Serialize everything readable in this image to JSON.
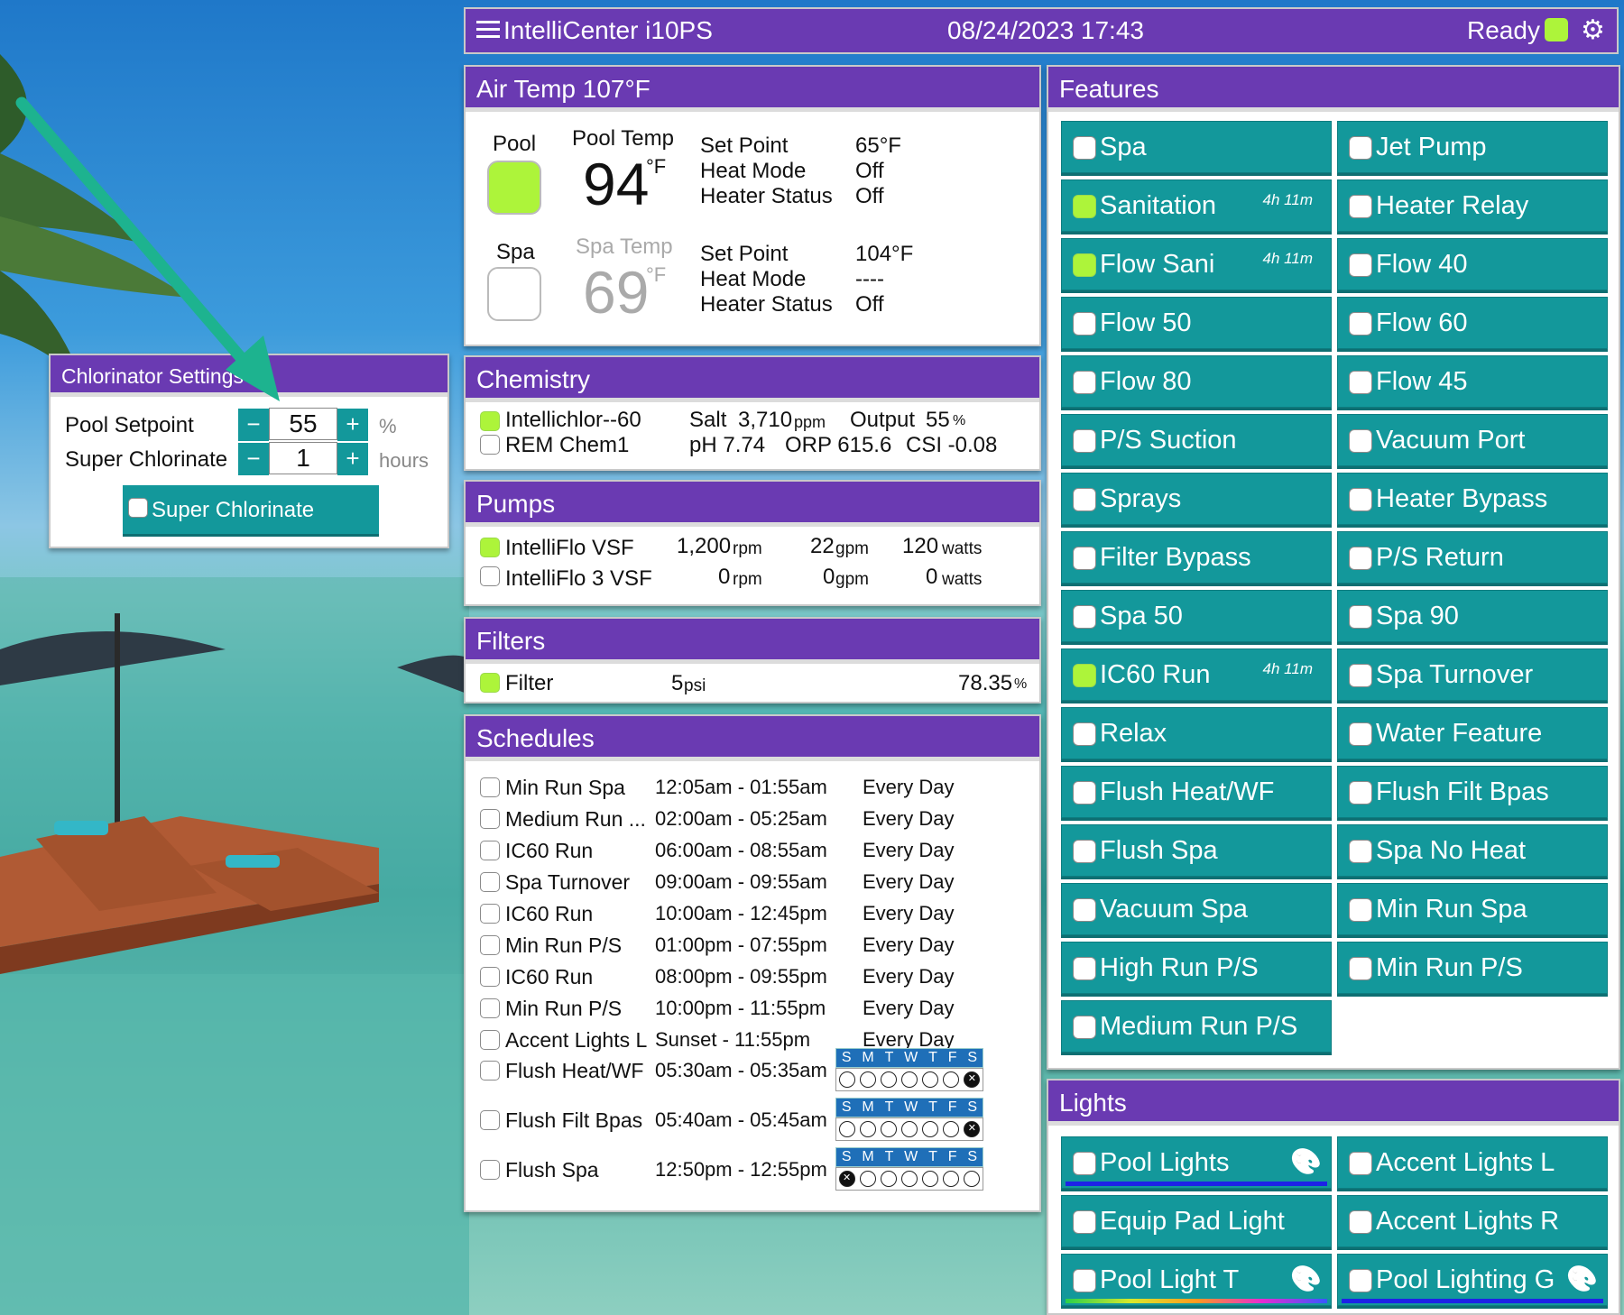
{
  "topbar": {
    "menu_icon": "hamburger-menu-icon",
    "title": "IntelliCenter i10PS",
    "datetime": "08/24/2023 17:43",
    "status": "Ready",
    "settings_icon": "gears-icon"
  },
  "airtemp": {
    "header": "Air Temp  107°F",
    "pool": {
      "label": "Pool",
      "temp_label": "Pool Temp",
      "temp": "94",
      "unit": "°F",
      "on": true,
      "setpoint_label": "Set Point",
      "setpoint": "65°F",
      "heatmode_label": "Heat Mode",
      "heatmode": "Off",
      "heater_label": "Heater Status",
      "heater": "Off"
    },
    "spa": {
      "label": "Spa",
      "temp_label": "Spa Temp",
      "temp": "69",
      "unit": "°F",
      "on": false,
      "setpoint_label": "Set Point",
      "setpoint": "104°F",
      "heatmode_label": "Heat Mode",
      "heatmode": "----",
      "heater_label": "Heater Status",
      "heater": "Off"
    }
  },
  "chemistry": {
    "header": "Chemistry",
    "rows": [
      {
        "name": "Intellichlor--60",
        "on": true
      },
      {
        "name": "REM Chem1",
        "on": false
      }
    ],
    "salt_label": "Salt",
    "salt": "3,710",
    "salt_unit": "ppm",
    "output_label": "Output",
    "output": "55",
    "output_unit": "%",
    "ph": "pH 7.74",
    "orp": "ORP 615.6",
    "csi": "CSI -0.08"
  },
  "pumps": {
    "header": "Pumps",
    "rows": [
      {
        "name": "IntelliFlo VSF",
        "on": true,
        "rpm": "1,200",
        "rpm_unit": "rpm",
        "gpm": "22",
        "gpm_unit": "gpm",
        "watts": "120",
        "watts_unit": "watts"
      },
      {
        "name": "IntelliFlo 3 VSF",
        "on": false,
        "rpm": "0",
        "rpm_unit": "rpm",
        "gpm": "0",
        "gpm_unit": "gpm",
        "watts": "0",
        "watts_unit": "watts"
      }
    ]
  },
  "filters": {
    "header": "Filters",
    "name": "Filter",
    "psi": "5",
    "psi_unit": "psi",
    "pct": "78.35",
    "pct_unit": "%"
  },
  "schedules": {
    "header": "Schedules",
    "day_letters": [
      "S",
      "M",
      "T",
      "W",
      "T",
      "F",
      "S"
    ],
    "rows": [
      {
        "name": "Min Run Spa",
        "time": "12:05am - 01:55am",
        "days": "Every Day"
      },
      {
        "name": "Medium Run ...",
        "time": "02:00am - 05:25am",
        "days": "Every Day"
      },
      {
        "name": "IC60 Run",
        "time": "06:00am - 08:55am",
        "days": "Every Day"
      },
      {
        "name": "Spa Turnover",
        "time": "09:00am - 09:55am",
        "days": "Every Day"
      },
      {
        "name": "IC60 Run",
        "time": "10:00am - 12:45pm",
        "days": "Every Day"
      },
      {
        "name": "Min Run P/S",
        "time": "01:00pm - 07:55pm",
        "days": "Every Day"
      },
      {
        "name": "IC60 Run",
        "time": "08:00pm - 09:55pm",
        "days": "Every Day"
      },
      {
        "name": "Min Run P/S",
        "time": "10:00pm - 11:55pm",
        "days": "Every Day"
      },
      {
        "name": "Accent Lights L",
        "time": "Sunset - 11:55pm",
        "days": "Every Day"
      },
      {
        "name": "Flush Heat/WF",
        "time": "05:30am - 05:35am",
        "days": "",
        "week": [
          0,
          0,
          0,
          0,
          0,
          0,
          1
        ]
      },
      {
        "name": "Flush Filt Bpas",
        "time": "05:40am - 05:45am",
        "days": "",
        "week": [
          0,
          0,
          0,
          0,
          0,
          0,
          1
        ]
      },
      {
        "name": "Flush Spa",
        "time": "12:50pm - 12:55pm",
        "days": "",
        "week": [
          1,
          0,
          0,
          0,
          0,
          0,
          0
        ]
      }
    ]
  },
  "features": {
    "header": "Features",
    "items": [
      {
        "label": "Spa",
        "on": false,
        "timer": ""
      },
      {
        "label": "Jet Pump",
        "on": false,
        "timer": ""
      },
      {
        "label": "Sanitation",
        "on": true,
        "timer": "4h 11m"
      },
      {
        "label": "Heater Relay",
        "on": false,
        "timer": ""
      },
      {
        "label": "Flow Sani",
        "on": true,
        "timer": "4h 11m"
      },
      {
        "label": "Flow 40",
        "on": false,
        "timer": ""
      },
      {
        "label": "Flow 50",
        "on": false,
        "timer": ""
      },
      {
        "label": "Flow 60",
        "on": false,
        "timer": ""
      },
      {
        "label": "Flow 80",
        "on": false,
        "timer": ""
      },
      {
        "label": "Flow 45",
        "on": false,
        "timer": ""
      },
      {
        "label": "P/S Suction",
        "on": false,
        "timer": ""
      },
      {
        "label": "Vacuum Port",
        "on": false,
        "timer": ""
      },
      {
        "label": "Sprays",
        "on": false,
        "timer": ""
      },
      {
        "label": "Heater Bypass",
        "on": false,
        "timer": ""
      },
      {
        "label": "Filter Bypass",
        "on": false,
        "timer": ""
      },
      {
        "label": "P/S Return",
        "on": false,
        "timer": ""
      },
      {
        "label": "Spa 50",
        "on": false,
        "timer": ""
      },
      {
        "label": "Spa 90",
        "on": false,
        "timer": ""
      },
      {
        "label": "IC60 Run",
        "on": true,
        "timer": "4h 11m"
      },
      {
        "label": "Spa Turnover",
        "on": false,
        "timer": ""
      },
      {
        "label": "Relax",
        "on": false,
        "timer": ""
      },
      {
        "label": "Water Feature",
        "on": false,
        "timer": ""
      },
      {
        "label": "Flush Heat/WF",
        "on": false,
        "timer": ""
      },
      {
        "label": "Flush Filt Bpas",
        "on": false,
        "timer": ""
      },
      {
        "label": "Flush Spa",
        "on": false,
        "timer": ""
      },
      {
        "label": "Spa No Heat",
        "on": false,
        "timer": ""
      },
      {
        "label": "Vacuum Spa",
        "on": false,
        "timer": ""
      },
      {
        "label": "Min Run Spa",
        "on": false,
        "timer": ""
      },
      {
        "label": "High Run P/S",
        "on": false,
        "timer": ""
      },
      {
        "label": "Min Run P/S",
        "on": false,
        "timer": ""
      },
      {
        "label": "Medium Run P/S",
        "on": false,
        "timer": ""
      }
    ]
  },
  "lights": {
    "header": "Lights",
    "items": [
      {
        "label": "Pool Lights",
        "palette": true,
        "bar": "blue"
      },
      {
        "label": "Accent Lights L",
        "palette": false,
        "bar": ""
      },
      {
        "label": "Equip Pad Light",
        "palette": false,
        "bar": ""
      },
      {
        "label": "Accent Lights R",
        "palette": false,
        "bar": ""
      },
      {
        "label": "Pool Light T",
        "palette": true,
        "bar": "rainbow"
      },
      {
        "label": "Pool Lighting G",
        "palette": true,
        "bar": "blue"
      }
    ]
  },
  "chlorinator": {
    "header": "Chlorinator Settings",
    "pool_label": "Pool Setpoint",
    "pool_value": "55",
    "pool_unit": "%",
    "super_label": "Super Chlorinate",
    "super_value": "1",
    "super_unit": "hours",
    "button": "Super Chlorinate",
    "minus": "−",
    "plus": "+"
  },
  "colors": {
    "header_purple": "#6a3ab2",
    "teal": "#13989b",
    "led_green": "#adf43a",
    "arrow": "#1db38f"
  }
}
